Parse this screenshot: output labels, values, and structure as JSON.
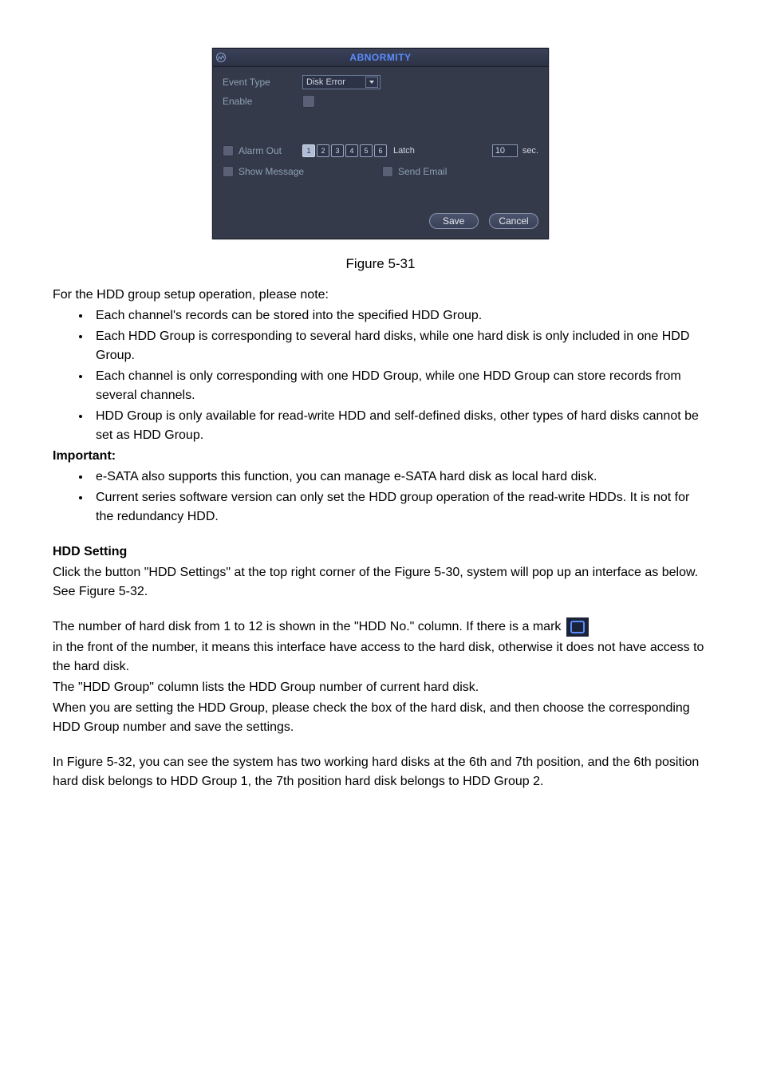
{
  "dialog": {
    "title": "ABNORMITY",
    "labels": {
      "event_type": "Event Type",
      "enable": "Enable",
      "alarm_out": "Alarm Out",
      "latch": "Latch",
      "sec": "sec.",
      "show_message": "Show Message",
      "send_email": "Send Email"
    },
    "select_value": "Disk Error",
    "channels": [
      "1",
      "2",
      "3",
      "4",
      "5",
      "6"
    ],
    "latch_value": "10",
    "buttons": {
      "save": "Save",
      "cancel": "Cancel"
    }
  },
  "figure_caption": "Figure 5-31",
  "intro": "For the HDD group setup operation, please note:",
  "bullets1": [
    "Each channel's records can be stored into the specified HDD Group.",
    "Each HDD Group is corresponding to several hard disks, while one hard disk is only included in one HDD Group.",
    "Each channel is only corresponding with one HDD Group, while one HDD Group can store records from several channels.",
    "HDD Group is only available for read-write HDD and self-defined disks, other types of hard disks cannot be set as HDD Group."
  ],
  "important_heading": "Important:",
  "bullets2": [
    "e-SATA also supports this function, you can manage e-SATA hard disk as local hard disk.",
    "Current series software version can only set the HDD group operation of the read-write HDDs. It is not for the redundancy HDD."
  ],
  "hdd_heading": "HDD Setting",
  "hdd_p1": "Click the button \"HDD Settings\" at the top right corner of the Figure 5-30, system will pop up an interface as below. See Figure 5-32.",
  "mark_line_prefix": "The number of hard disk from 1 to 12 is shown in the \"HDD No.\" column. If there is a mark",
  "mark_line_suffix": "in the front of the number, it means this interface have access to the hard disk, otherwise it does not have access to the hard disk.",
  "hdd_p3": "The \"HDD Group\" column lists the HDD Group number of current hard disk.",
  "hdd_p4": "When you are setting the HDD Group, please check the box of the hard disk, and then choose the corresponding HDD Group number and save the settings.",
  "hdd_p5": "In Figure 5-32, you can see the system has two working hard disks at the 6th and 7th position, and the 6th position hard disk belongs to HDD Group 1, the 7th position hard disk belongs to HDD Group 2."
}
